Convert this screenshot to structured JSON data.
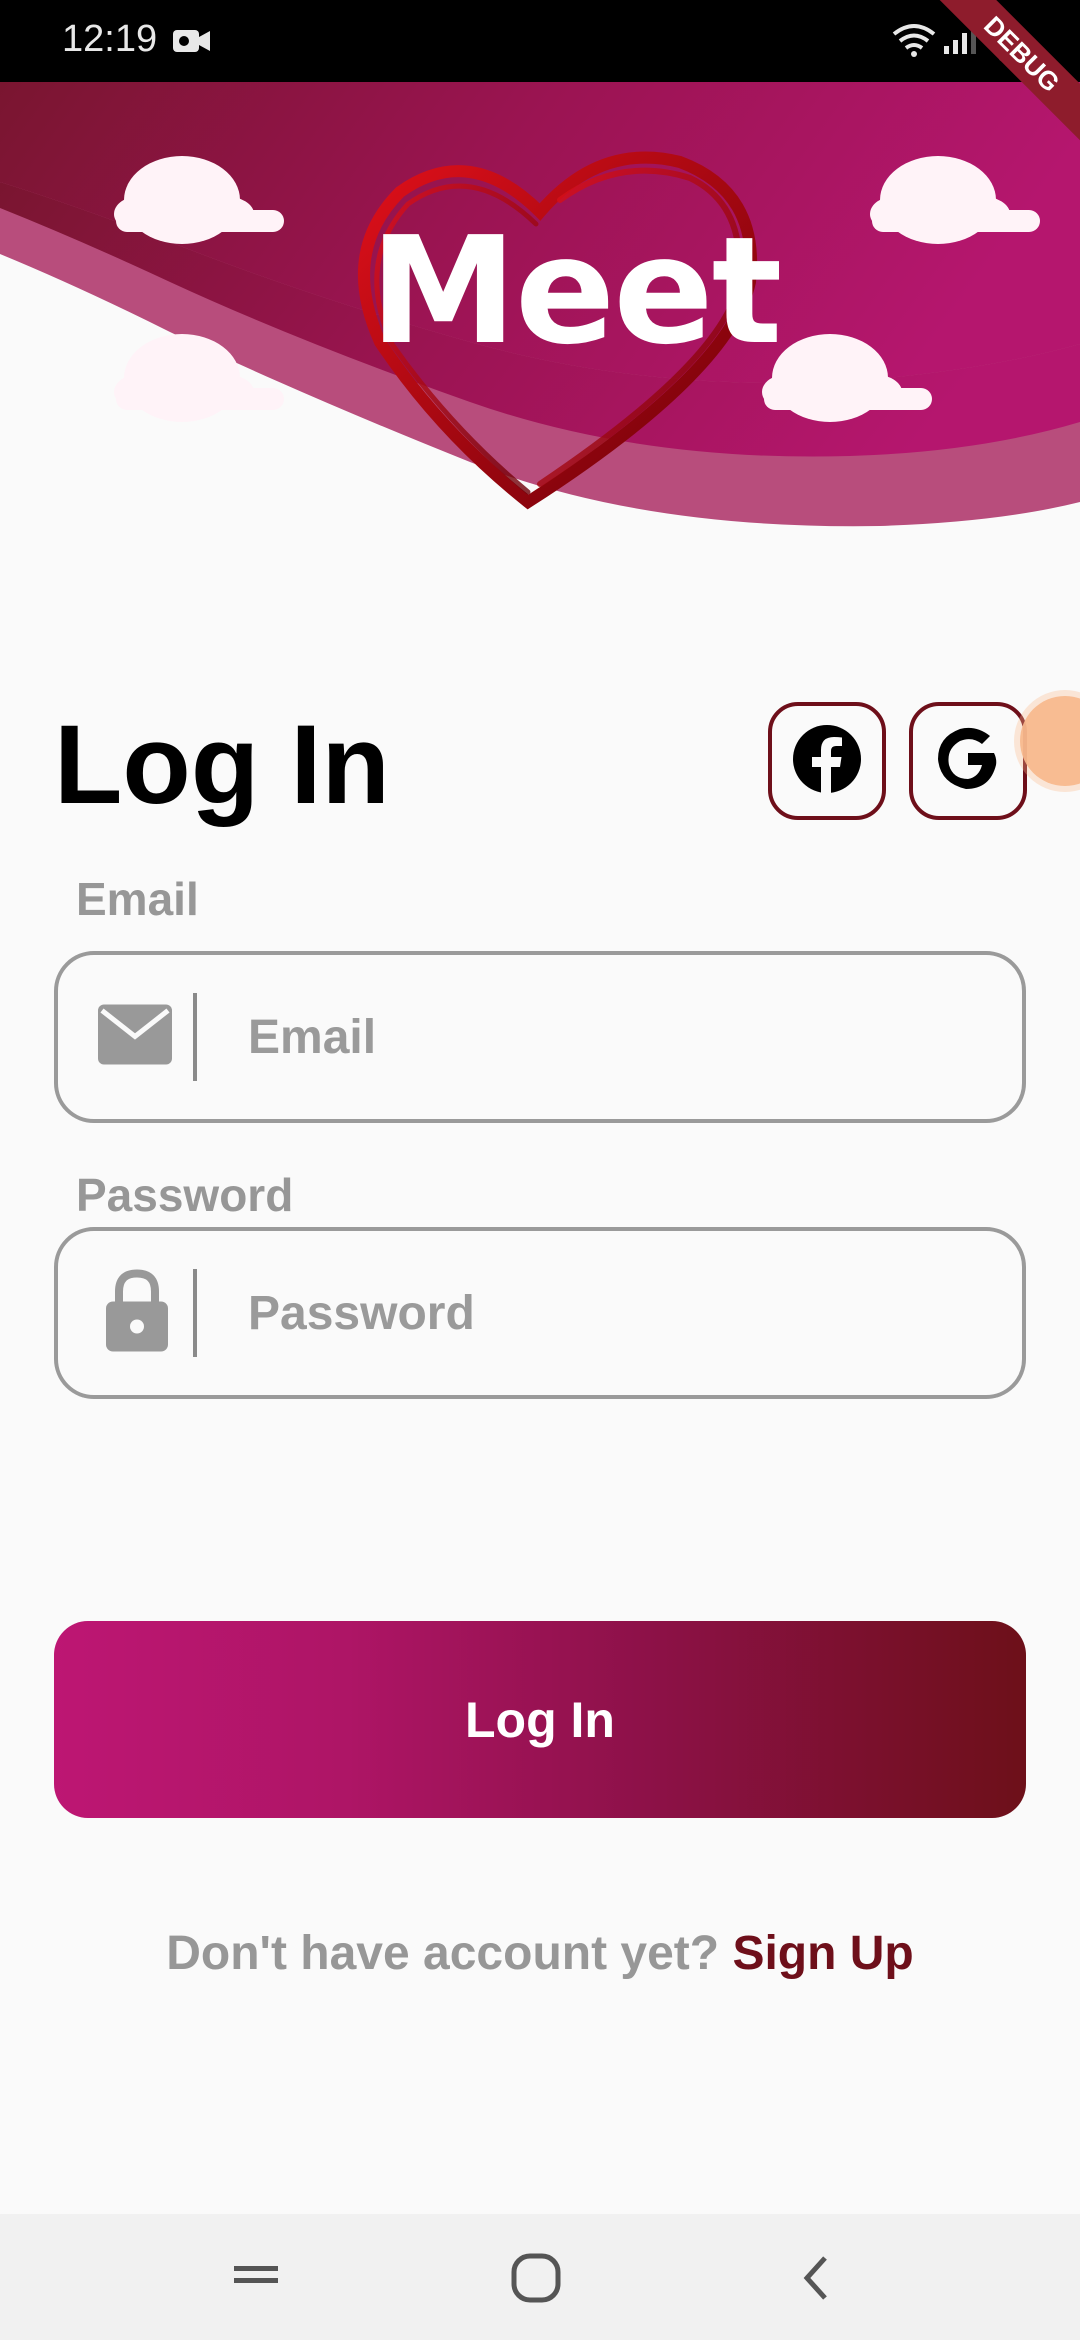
{
  "status_bar": {
    "time": "12:19",
    "debug_label": "DEBUG"
  },
  "header": {
    "brand": "Meet"
  },
  "login": {
    "title": "Log In",
    "social": {
      "facebook_icon": "facebook-icon",
      "google_icon": "google-icon"
    },
    "email": {
      "label": "Email",
      "placeholder": "Email",
      "icon": "envelope-icon"
    },
    "password": {
      "label": "Password",
      "placeholder": "Password",
      "icon": "lock-icon"
    },
    "submit_label": "Log In",
    "signup_prompt": "Don't have account yet?",
    "signup_link": "Sign Up"
  },
  "colors": {
    "brand_dark": "#6e0f1a",
    "brand_pink": "#bd1673",
    "muted_text": "#979797"
  }
}
